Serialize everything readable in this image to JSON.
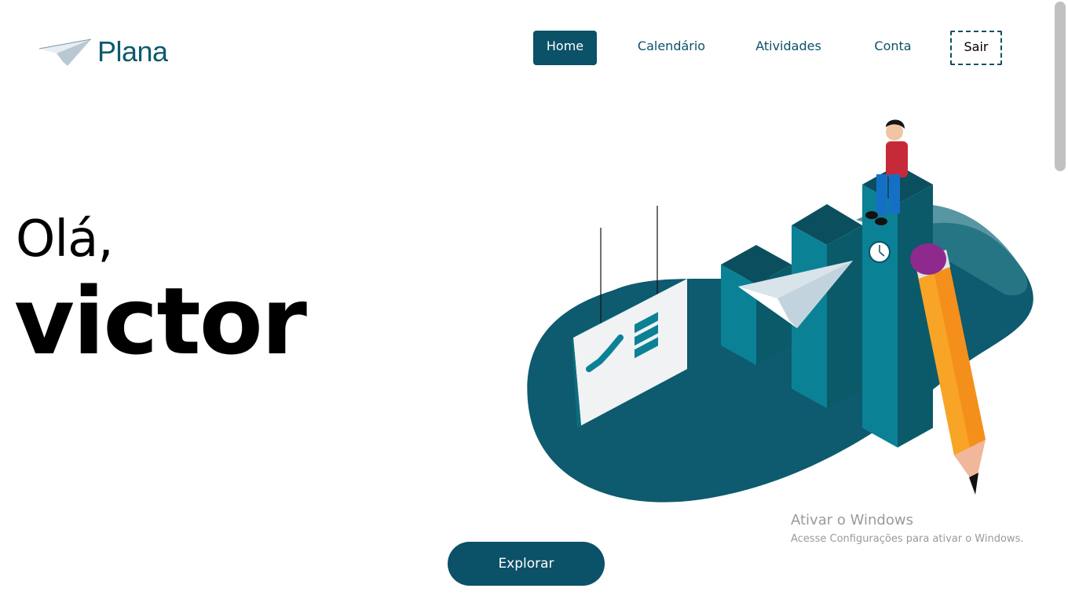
{
  "brand": {
    "name": "Plana",
    "icon": "paper-plane-icon"
  },
  "nav": {
    "home": "Home",
    "calendar": "Calendário",
    "activities": "Atividades",
    "account": "Conta",
    "logout": "Sair"
  },
  "hero": {
    "greeting": "Olá,",
    "user_name": "victor",
    "cta": "Explorar"
  },
  "watermark": {
    "title": "Ativar o Windows",
    "subtitle": "Acesse Configurações para ativar o Windows."
  },
  "colors": {
    "primary": "#0b5168",
    "logo": "#0e5a6e",
    "blob": "#0e5a6e",
    "bar": "#0b8196",
    "pencil": "#f7a427",
    "eraser": "#8e2a8e"
  }
}
